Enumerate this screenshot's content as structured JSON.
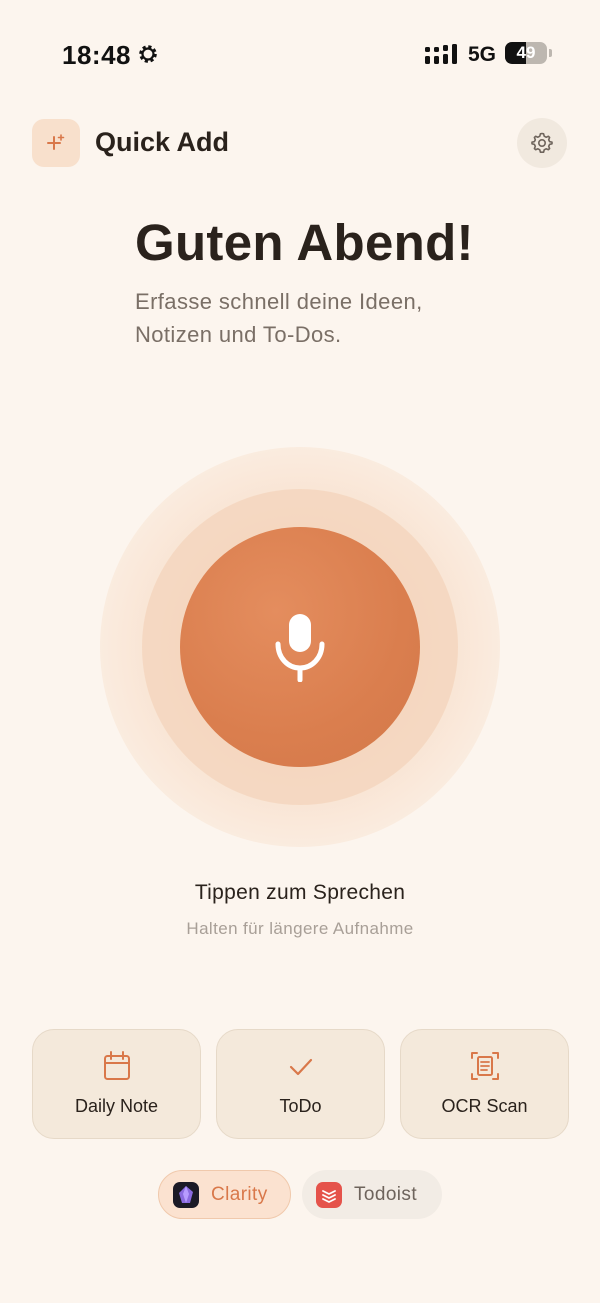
{
  "status_bar": {
    "time": "18:48",
    "network": "5G",
    "battery_percent": 49,
    "battery_label": "49"
  },
  "header": {
    "title": "Quick Add",
    "logo_icon": "sparkle-icon",
    "settings_icon": "gear-icon"
  },
  "greeting": {
    "title": "Guten Abend!",
    "subtitle": "Erfasse schnell deine Ideen, Notizen und To-Dos."
  },
  "recorder": {
    "icon": "microphone-icon",
    "hint": "Tippen zum Sprechen",
    "subhint": "Halten für längere Aufnahme"
  },
  "actions": [
    {
      "label": "Daily Note",
      "icon": "calendar-icon"
    },
    {
      "label": "ToDo",
      "icon": "checkmark-icon"
    },
    {
      "label": "OCR Scan",
      "icon": "document-scan-icon"
    }
  ],
  "integrations": [
    {
      "label": "Clarity",
      "icon": "clarity-crystal-icon",
      "selected": true
    },
    {
      "label": "Todoist",
      "icon": "todoist-icon",
      "selected": false
    }
  ],
  "colors": {
    "background": "#FCF5EE",
    "accent": "#DA7E4E",
    "text_primary": "#2A221C",
    "text_secondary": "#7A6F66",
    "card_background": "#F4E9DB"
  }
}
